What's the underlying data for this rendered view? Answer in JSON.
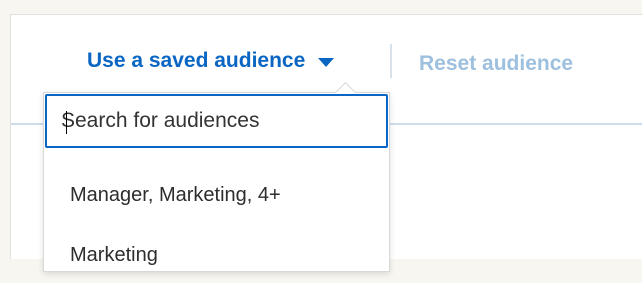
{
  "toolbar": {
    "saved_audience_label": "Use a saved audience",
    "reset_audience_label": "Reset audience"
  },
  "dropdown": {
    "search_placeholder": "Search for audiences",
    "search_value": "",
    "options": [
      {
        "label": "Manager, Marketing, 4+"
      },
      {
        "label": "Marketing"
      }
    ]
  },
  "colors": {
    "accent": "#0a66c2",
    "disabled_link": "#9ec0df",
    "page_background": "#f8f6f0"
  },
  "icons": {
    "saved_audience_caret": "caret-down-icon"
  }
}
